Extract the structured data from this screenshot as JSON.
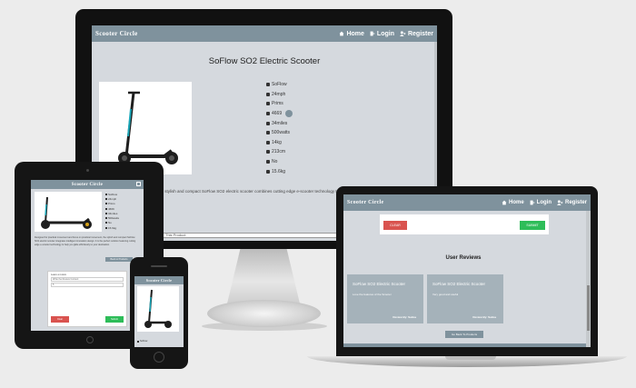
{
  "site": {
    "brand": "Scooter Circle"
  },
  "nav": {
    "home": "Home",
    "login": "Login",
    "register": "Register"
  },
  "product": {
    "title": "SoFlow SO2 Electric Scooter",
    "specs": [
      "SoFlow",
      "24mph",
      "Prims",
      "4669",
      "34miles",
      "500watts",
      "14kg",
      "213cm",
      "No",
      "15.6kg"
    ],
    "description": "In focus on practical movement, the stylish and compact SoFlow SO2 electric scooter combines cutting edge e-scooter technology to help you glide effortlessly to your destination.",
    "review_input": "This Product"
  },
  "tablet": {
    "description": "Designed for practical movement and focus on practical movement, the stylish and compact SoFlow SO2 electric scooter integrates intelligent innovation design. It is the perfect solution featuring cutting edge e-scooter technology to help you glide effortlessly to your destination.",
    "back_button": "Back to Products",
    "form_label": "Leave a review",
    "form_placeholder": "Write the Review Content",
    "form_rating": "5",
    "clear": "Clear",
    "submit": "Submit"
  },
  "phone": {
    "spec": "SoFlow"
  },
  "laptop": {
    "clear": "CLEAR",
    "submit": "SUBMIT",
    "reviews_heading": "User Reviews",
    "reviews": [
      {
        "title": "SoFlow SO2 Electric Scooter",
        "text": "Love the features of the Scooter",
        "by": "Review By: Salma"
      },
      {
        "title": "SoFlow SO2 Electric Scooter",
        "text": "Very good and useful",
        "by": "Review By: Salma"
      }
    ],
    "back_button": "Go Back To Products"
  }
}
